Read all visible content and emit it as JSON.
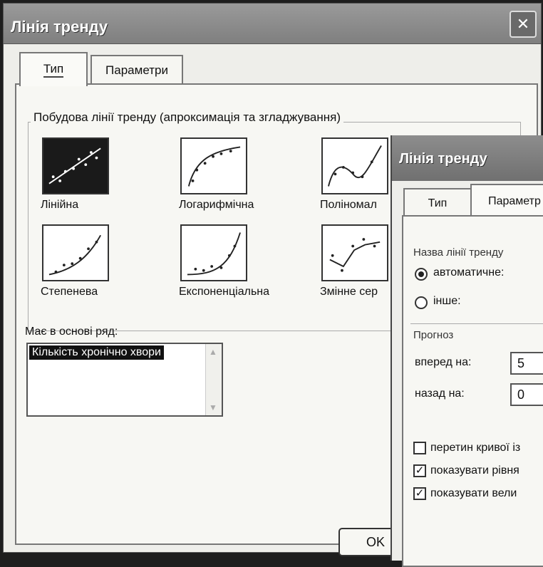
{
  "dialog": {
    "title": "Лінія тренду",
    "close_glyph": "✕",
    "tabs": [
      {
        "label": "Тип",
        "active": true
      },
      {
        "label": "Параметри",
        "active": false
      }
    ],
    "group_title": "Побудова лінії тренду (апроксимація та згладжування)",
    "trend_types": [
      {
        "label": "Лінійна",
        "icon": "linear-trend-icon",
        "selected": true
      },
      {
        "label": "Логарифмічна",
        "icon": "logarithmic-trend-icon",
        "selected": false
      },
      {
        "label": "Поліномал",
        "icon": "polynomial-trend-icon",
        "selected": false
      },
      {
        "label": "Степенева",
        "icon": "power-trend-icon",
        "selected": false
      },
      {
        "label": "Експоненціальна",
        "icon": "exponential-trend-icon",
        "selected": false
      },
      {
        "label": "Змінне сер",
        "icon": "moving-average-icon",
        "selected": false
      }
    ],
    "series_label": "Має в основі ряд:",
    "series_items": [
      "Кількість хронічно хвори"
    ],
    "ok_label": "OK"
  },
  "dialog2": {
    "title": "Лінія тренду",
    "tabs": [
      {
        "label": "Тип",
        "active": false
      },
      {
        "label": "Параметр",
        "active": true
      }
    ],
    "name_group": "Назва лінії тренду",
    "radio_auto": "автоматичне:",
    "radio_other": "інше:",
    "forecast_group": "Прогноз",
    "forward_label": "вперед на:",
    "forward_value": "5",
    "backward_label": "назад на:",
    "backward_value": "0",
    "checkboxes": [
      {
        "label": "перетин кривої із",
        "checked": false
      },
      {
        "label": "показувати рівня",
        "checked": true
      },
      {
        "label": "показувати вели",
        "checked": true
      }
    ],
    "check_glyph": "✓"
  }
}
